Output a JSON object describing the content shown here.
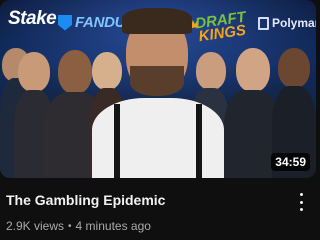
{
  "video": {
    "title": "The Gambling Epidemic",
    "views": "2.9K views",
    "separator": "•",
    "age": "4 minutes ago",
    "duration": "34:59"
  },
  "thumbnail": {
    "logos": {
      "stake": "Stake",
      "fanduel": "FANDUEL",
      "draftkings_top": "DRAFT",
      "draftkings_bottom": "KINGS",
      "polymarket": "Polymarket"
    }
  },
  "icons": {
    "more": "more-vert-icon"
  }
}
